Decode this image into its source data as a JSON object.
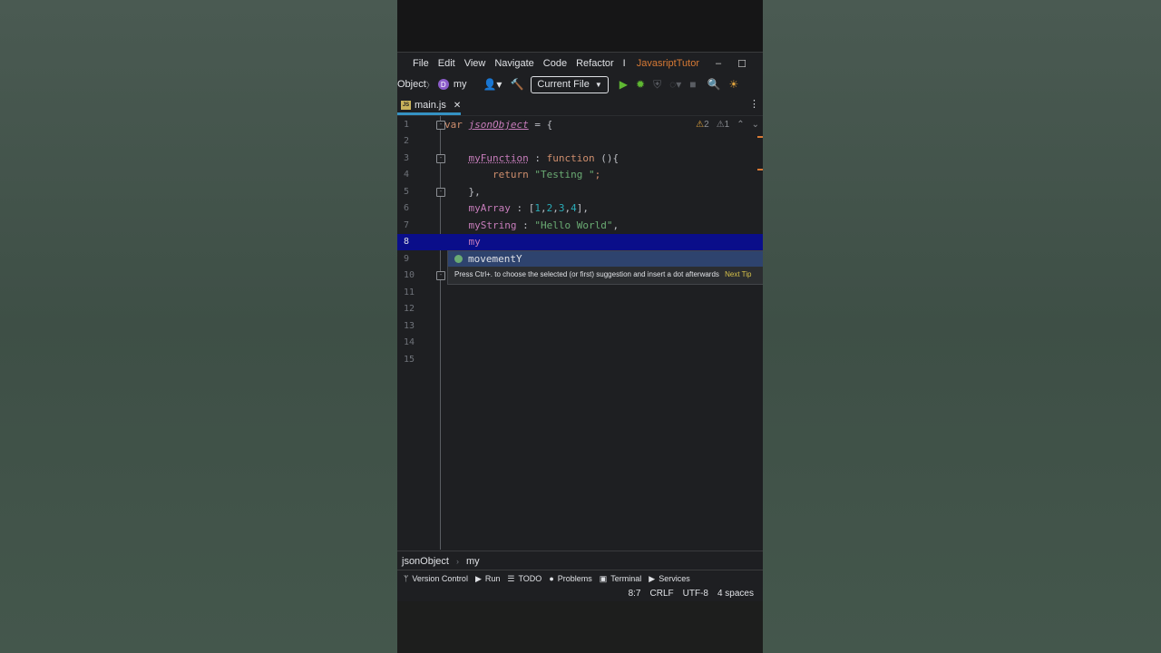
{
  "menu": {
    "items": [
      "File",
      "Edit",
      "View",
      "Navigate",
      "Code",
      "Refactor",
      "I"
    ],
    "project": "JavasriptTutor",
    "minimize": "–",
    "maximize": "☐"
  },
  "toolbar": {
    "crumb_object": "Object",
    "crumb_sep": "〉",
    "crumb_badge": "D",
    "crumb_my": "my",
    "run_config": "Current File"
  },
  "tab": {
    "label": "main.js",
    "close": "✕",
    "icon": "JS"
  },
  "editor": {
    "line_numbers": [
      "1",
      "2",
      "3",
      "4",
      "5",
      "6",
      "7",
      "8",
      "9",
      "10",
      "11",
      "12",
      "13",
      "14",
      "15"
    ],
    "warnings": {
      "warn_count": "2",
      "weak_count": "1"
    },
    "lines": {
      "l1_kw": "var",
      "l1_name": "jsonObject",
      "l1_rest": " = {",
      "l3_prop": "myFunction",
      "l3_rest": " : ",
      "l3_kw": "function",
      "l3_end": " (){",
      "l4_kw": "return",
      "l4_str": "\"Testing \"",
      "l4_end": ";",
      "l5": "},",
      "l6_prop": "myArray",
      "l6_rest": " : [",
      "l6_n1": "1",
      "l6_n2": "2",
      "l6_n3": "3",
      "l6_n4": "4",
      "l6_end": "],",
      "l7_prop": "myString",
      "l7_rest": " : ",
      "l7_str": "\"Hello World\"",
      "l7_end": ",",
      "l8": "my"
    }
  },
  "completion": {
    "suggestion": "movementY",
    "hint": "Press Ctrl+. to choose the selected (or first) suggestion and insert a dot afterwards",
    "next_tip": "Next Tip"
  },
  "navbar": {
    "item1": "jsonObject",
    "sep": "›",
    "item2": "my"
  },
  "toolwindows": [
    "Version Control",
    "Run",
    "TODO",
    "Problems",
    "Terminal",
    "Services"
  ],
  "status": {
    "position": "8:7",
    "line_sep": "CRLF",
    "encoding": "UTF-8",
    "indent": "4 spaces"
  }
}
